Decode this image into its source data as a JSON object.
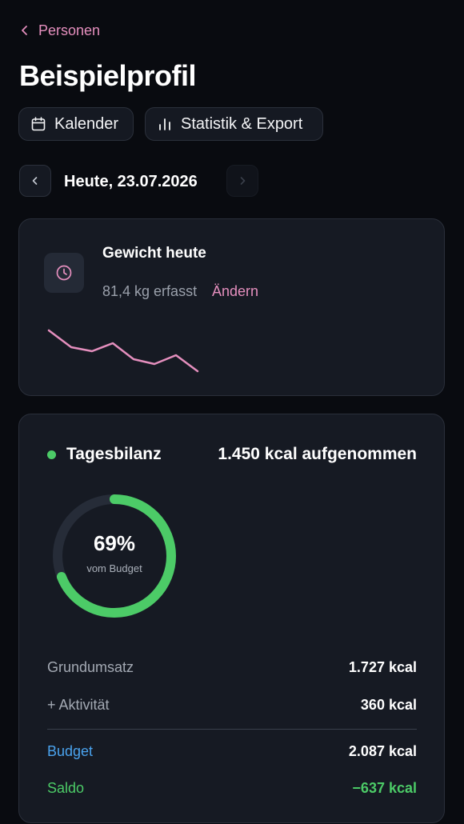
{
  "nav": {
    "back_label": "Personen",
    "back_icon": "chevron-left-icon"
  },
  "page": {
    "title": "Beispielprofil"
  },
  "actions": {
    "calendar_label": "Kalender",
    "calendar_icon": "calendar-icon",
    "stats_label": "Statistik & Export",
    "stats_icon": "bar-chart-icon"
  },
  "date_nav": {
    "label": "Heute, 23.07.2026",
    "prev_icon": "chevron-left-icon",
    "next_icon": "chevron-right-icon"
  },
  "weight": {
    "title": "Gewicht heute",
    "value": "81,4 kg erfasst",
    "edit_label": "Ändern",
    "icon": "clock-icon"
  },
  "balance": {
    "title": "Tagesbilanz",
    "consumed": "1.450 kcal aufgenommen",
    "percent_label": "69%",
    "percent_value": 0.69,
    "percent_sub": "vom Budget",
    "rows": [
      {
        "label": "Grundumsatz",
        "value": "1.727 kcal"
      },
      {
        "label": "+ Aktivität",
        "value": "360 kcal"
      },
      {
        "label": "Budget",
        "value": "2.087 kcal"
      },
      {
        "label": "Saldo",
        "value": "−637 kcal"
      }
    ]
  },
  "colors": {
    "accent_pink": "#e58fbe",
    "accent_green": "#4ccb67",
    "accent_blue": "#4aa3ee",
    "background": "#090b10",
    "card": "#161a23"
  }
}
